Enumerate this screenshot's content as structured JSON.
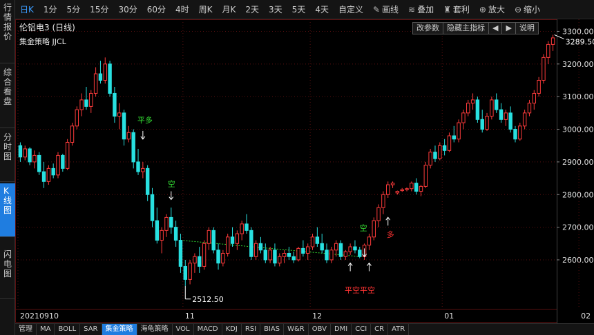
{
  "sidebar": {
    "tabs": [
      {
        "label": "行情报价",
        "active": false
      },
      {
        "label": "综合看盘",
        "active": false
      },
      {
        "label": "分时图",
        "active": false
      },
      {
        "label": "K线图",
        "active": true
      },
      {
        "label": "闪电图",
        "active": false
      }
    ]
  },
  "toolbar": {
    "periods": [
      "日K",
      "1分",
      "5分",
      "15分",
      "30分",
      "60分",
      "4时",
      "周K",
      "月K",
      "2天",
      "3天",
      "5天",
      "4天",
      "自定义"
    ],
    "active_period": "日K",
    "tools": [
      {
        "icon": "pen-icon",
        "glyph": "✎",
        "label": "画线"
      },
      {
        "icon": "stack-icon",
        "glyph": "≋",
        "label": "叠加"
      },
      {
        "icon": "bag-icon",
        "glyph": "♜",
        "label": "套利"
      },
      {
        "icon": "zoom-in-icon",
        "glyph": "⊕",
        "label": "放大"
      },
      {
        "icon": "zoom-out-icon",
        "glyph": "⊖",
        "label": "缩小"
      }
    ]
  },
  "chart_header": {
    "title": "伦铝电3 (日线)",
    "indicator": "集金策略 JJCL",
    "buttons": [
      "改参数",
      "隐藏主指标",
      "◀",
      "▶",
      "说明"
    ]
  },
  "chart_data": {
    "type": "candlestick",
    "ylim": [
      2450,
      3320
    ],
    "y_ticks": [
      "3300.00",
      "3200.00",
      "3100.00",
      "3000.00",
      "2900.00",
      "2800.00",
      "2700.00",
      "2600.00"
    ],
    "x_labels": [
      {
        "label": "20210910",
        "index": 0
      },
      {
        "label": "11",
        "index": 35
      },
      {
        "label": "12",
        "index": 62
      },
      {
        "label": "01",
        "index": 90
      },
      {
        "label": "02",
        "index": 119
      }
    ],
    "annotations": {
      "high": "3289.50",
      "low": "2512.50",
      "signals": [
        {
          "text": "平多",
          "color": "#33dd33",
          "index": 26
        },
        {
          "text": "空",
          "color": "#33dd33",
          "index": 32
        },
        {
          "text": "空",
          "color": "#33dd33",
          "index": 73
        },
        {
          "text": "多",
          "color": "#ff3333",
          "index": 78
        },
        {
          "text": "平空平空",
          "color": "#ff3333",
          "index": 72
        }
      ]
    },
    "candles": [
      [
        2950,
        2960,
        2900,
        2915
      ],
      [
        2915,
        2950,
        2905,
        2940
      ],
      [
        2940,
        2945,
        2890,
        2900
      ],
      [
        2900,
        2935,
        2880,
        2920
      ],
      [
        2920,
        2930,
        2860,
        2870
      ],
      [
        2870,
        2900,
        2820,
        2840
      ],
      [
        2840,
        2890,
        2830,
        2880
      ],
      [
        2880,
        2895,
        2850,
        2860
      ],
      [
        2860,
        2930,
        2850,
        2920
      ],
      [
        2920,
        2925,
        2870,
        2880
      ],
      [
        2880,
        2970,
        2875,
        2960
      ],
      [
        2960,
        3020,
        2950,
        3010
      ],
      [
        3010,
        3070,
        3000,
        3060
      ],
      [
        3060,
        3110,
        3040,
        3090
      ],
      [
        3090,
        3130,
        3060,
        3070
      ],
      [
        3070,
        3120,
        3050,
        3110
      ],
      [
        3110,
        3190,
        3100,
        3170
      ],
      [
        3170,
        3210,
        3140,
        3150
      ],
      [
        3150,
        3220,
        3140,
        3200
      ],
      [
        3200,
        3210,
        3100,
        3110
      ],
      [
        3110,
        3130,
        3020,
        3040
      ],
      [
        3040,
        3080,
        3000,
        3050
      ],
      [
        3050,
        3060,
        2950,
        2970
      ],
      [
        2970,
        3010,
        2960,
        2990
      ],
      [
        2990,
        3000,
        2880,
        2900
      ],
      [
        2900,
        2940,
        2860,
        2870
      ],
      [
        2870,
        2900,
        2850,
        2880
      ],
      [
        2880,
        2890,
        2780,
        2800
      ],
      [
        2800,
        2820,
        2700,
        2720
      ],
      [
        2720,
        2760,
        2650,
        2660
      ],
      [
        2660,
        2700,
        2620,
        2690
      ],
      [
        2690,
        2740,
        2670,
        2730
      ],
      [
        2730,
        2760,
        2680,
        2700
      ],
      [
        2700,
        2720,
        2640,
        2660
      ],
      [
        2660,
        2680,
        2560,
        2580
      ],
      [
        2580,
        2600,
        2520,
        2540
      ],
      [
        2540,
        2600,
        2525,
        2590
      ],
      [
        2590,
        2620,
        2560,
        2610
      ],
      [
        2610,
        2640,
        2560,
        2580
      ],
      [
        2580,
        2660,
        2570,
        2650
      ],
      [
        2650,
        2700,
        2630,
        2690
      ],
      [
        2690,
        2700,
        2620,
        2630
      ],
      [
        2630,
        2650,
        2570,
        2590
      ],
      [
        2590,
        2630,
        2580,
        2620
      ],
      [
        2620,
        2680,
        2610,
        2670
      ],
      [
        2670,
        2700,
        2640,
        2650
      ],
      [
        2650,
        2690,
        2630,
        2680
      ],
      [
        2680,
        2720,
        2660,
        2710
      ],
      [
        2710,
        2740,
        2680,
        2690
      ],
      [
        2690,
        2700,
        2600,
        2610
      ],
      [
        2610,
        2660,
        2600,
        2650
      ],
      [
        2650,
        2670,
        2620,
        2630
      ],
      [
        2630,
        2650,
        2590,
        2600
      ],
      [
        2600,
        2640,
        2590,
        2630
      ],
      [
        2630,
        2650,
        2580,
        2590
      ],
      [
        2590,
        2620,
        2580,
        2610
      ],
      [
        2610,
        2630,
        2590,
        2620
      ],
      [
        2620,
        2640,
        2600,
        2610
      ],
      [
        2610,
        2625,
        2590,
        2600
      ],
      [
        2600,
        2640,
        2595,
        2635
      ],
      [
        2635,
        2660,
        2610,
        2620
      ],
      [
        2620,
        2650,
        2600,
        2640
      ],
      [
        2640,
        2680,
        2630,
        2670
      ],
      [
        2670,
        2700,
        2640,
        2650
      ],
      [
        2650,
        2680,
        2620,
        2630
      ],
      [
        2630,
        2650,
        2590,
        2600
      ],
      [
        2600,
        2640,
        2590,
        2630
      ],
      [
        2630,
        2660,
        2610,
        2650
      ],
      [
        2650,
        2660,
        2600,
        2610
      ],
      [
        2610,
        2630,
        2600,
        2625
      ],
      [
        2625,
        2650,
        2615,
        2640
      ],
      [
        2640,
        2660,
        2620,
        2630
      ],
      [
        2630,
        2640,
        2605,
        2610
      ],
      [
        2610,
        2650,
        2600,
        2645
      ],
      [
        2645,
        2680,
        2630,
        2670
      ],
      [
        2670,
        2730,
        2660,
        2720
      ],
      [
        2720,
        2770,
        2700,
        2760
      ],
      [
        2760,
        2810,
        2740,
        2800
      ],
      [
        2800,
        2840,
        2790,
        2830
      ],
      [
        2830,
        2840,
        2820,
        2835
      ],
      [
        2805,
        2812,
        2800,
        2810
      ],
      [
        2812,
        2820,
        2808,
        2815
      ],
      [
        2815,
        2822,
        2810,
        2818
      ],
      [
        2818,
        2840,
        2810,
        2835
      ],
      [
        2835,
        2850,
        2800,
        2810
      ],
      [
        2810,
        2830,
        2795,
        2825
      ],
      [
        2825,
        2900,
        2820,
        2890
      ],
      [
        2890,
        2940,
        2880,
        2930
      ],
      [
        2930,
        2950,
        2900,
        2910
      ],
      [
        2910,
        2960,
        2905,
        2950
      ],
      [
        2950,
        2970,
        2920,
        2935
      ],
      [
        2935,
        2990,
        2930,
        2980
      ],
      [
        2980,
        3010,
        2960,
        2970
      ],
      [
        2970,
        3030,
        2960,
        3020
      ],
      [
        3020,
        3060,
        3000,
        3050
      ],
      [
        3050,
        3090,
        3040,
        3080
      ],
      [
        3080,
        3110,
        3060,
        3090
      ],
      [
        3090,
        3100,
        3020,
        3030
      ],
      [
        3030,
        3060,
        2990,
        3000
      ],
      [
        3000,
        3050,
        2995,
        3040
      ],
      [
        3040,
        3100,
        3030,
        3090
      ],
      [
        3090,
        3110,
        3050,
        3060
      ],
      [
        3060,
        3080,
        3020,
        3030
      ],
      [
        3030,
        3060,
        3010,
        3050
      ],
      [
        3050,
        3070,
        2990,
        3000
      ],
      [
        3000,
        3010,
        2960,
        2970
      ],
      [
        2970,
        3020,
        2965,
        3010
      ],
      [
        3010,
        3060,
        3000,
        3050
      ],
      [
        3050,
        3090,
        3040,
        3080
      ],
      [
        3080,
        3120,
        3060,
        3110
      ],
      [
        3110,
        3160,
        3100,
        3150
      ],
      [
        3150,
        3230,
        3140,
        3220
      ],
      [
        3220,
        3270,
        3200,
        3260
      ],
      [
        3260,
        3289.5,
        3240,
        3280
      ]
    ]
  },
  "bottom_tabs": [
    "管理",
    "MA",
    "BOLL",
    "SAR",
    "集金策略",
    "海龟策略",
    "VOL",
    "MACD",
    "KDJ",
    "RSI",
    "BIAS",
    "W&R",
    "OBV",
    "DMI",
    "CCI",
    "CR",
    "ATR"
  ],
  "active_bottom_tab": "集金策略",
  "colors": {
    "up": "#ff3b3b",
    "down": "#28e0e0",
    "grid": "#5a1010",
    "axis_text": "#e0e0e0",
    "signal_line": "#33dd33"
  }
}
